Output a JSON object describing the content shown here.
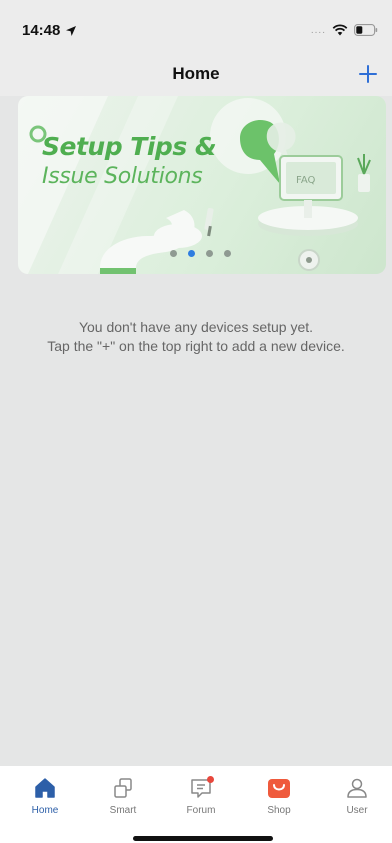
{
  "status_bar": {
    "time": "14:48",
    "signal": "....",
    "icons": [
      "location-arrow-icon",
      "wifi-icon",
      "battery-icon"
    ]
  },
  "header": {
    "title": "Home",
    "add_icon": "plus-icon",
    "accent_color": "#2f6fd6"
  },
  "banner": {
    "title": "Setup Tips &",
    "subtitle": "Issue Solutions",
    "screen_text": "FAQ",
    "slide_count": 4,
    "active_slide": 2,
    "title_color": "#4fae50"
  },
  "empty_state": {
    "line1": "You don't have any devices setup yet.",
    "line2": "Tap the \"+\" on the top right to add a new device."
  },
  "tabs": [
    {
      "label": "Home",
      "icon": "house-icon",
      "active": true
    },
    {
      "label": "Smart",
      "icon": "cubes-icon",
      "active": false
    },
    {
      "label": "Forum",
      "icon": "chat-icon",
      "active": false,
      "badge": true
    },
    {
      "label": "Shop",
      "icon": "shopping-bag-icon",
      "active": false
    },
    {
      "label": "User",
      "icon": "person-icon",
      "active": false
    }
  ]
}
